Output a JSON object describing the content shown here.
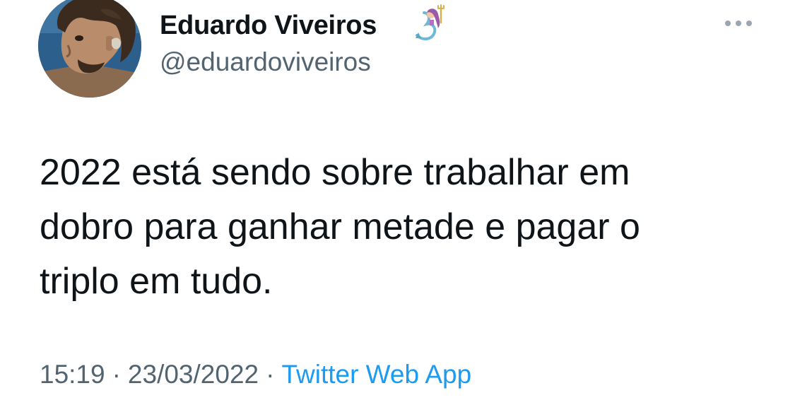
{
  "tweet": {
    "author": {
      "display_name": "Eduardo Viveiros",
      "handle": "@eduardoviveiros",
      "name_emoji": "merperson-emoji"
    },
    "text_lines": [
      "2022 está sendo sobre trabalhar em",
      "dobro para ganhar metade e pagar o",
      "triplo em tudo."
    ],
    "meta": {
      "time": "15:19",
      "separator": "·",
      "date": "23/03/2022",
      "source": "Twitter Web App"
    }
  },
  "icons": {
    "more": "more-dots-icon",
    "avatar": "profile-photo"
  },
  "colors": {
    "name": "#0f1419",
    "secondary_text": "#536471",
    "link": "#1d9bf0",
    "background": "#ffffff"
  }
}
